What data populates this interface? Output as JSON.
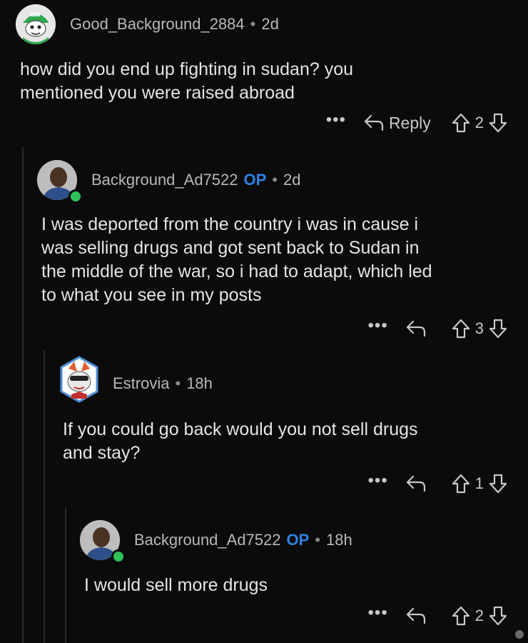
{
  "comments": [
    {
      "author": "Good_Background_2884",
      "op_badge": "",
      "separator": "•",
      "time": "2d",
      "body": "how did you end up fighting in sudan? you\nmentioned you were raised abroad",
      "more": "•••",
      "reply_label": "Reply",
      "score": "2"
    },
    {
      "author": "Background_Ad7522",
      "op_badge": "OP",
      "separator": "•",
      "time": "2d",
      "body": "I was deported from the country i was in cause i\nwas selling drugs and got sent back to Sudan in\nthe middle of the war, so i had to adapt, which led\nto what you see in my posts",
      "more": "•••",
      "reply_label": "",
      "score": "3"
    },
    {
      "author": "Estrovia",
      "op_badge": "",
      "separator": "•",
      "time": "18h",
      "body": "If you could go back would you not sell drugs\nand stay?",
      "more": "•••",
      "reply_label": "",
      "score": "1"
    },
    {
      "author": "Background_Ad7522",
      "op_badge": "OP",
      "separator": "•",
      "time": "18h",
      "body": "I would sell more drugs",
      "more": "•••",
      "reply_label": "",
      "score": "2"
    }
  ],
  "icons": {
    "reply": "reply-arrow-icon",
    "upvote": "upvote-arrow-icon",
    "downvote": "downvote-arrow-icon",
    "more": "more-options-icon",
    "online": "online-status-icon"
  },
  "colors": {
    "background": "#0b0b0b",
    "op_badge": "#2f82e6",
    "online": "#2ec15a",
    "text": "#e4e4e4",
    "meta": "#b8b8b8"
  }
}
